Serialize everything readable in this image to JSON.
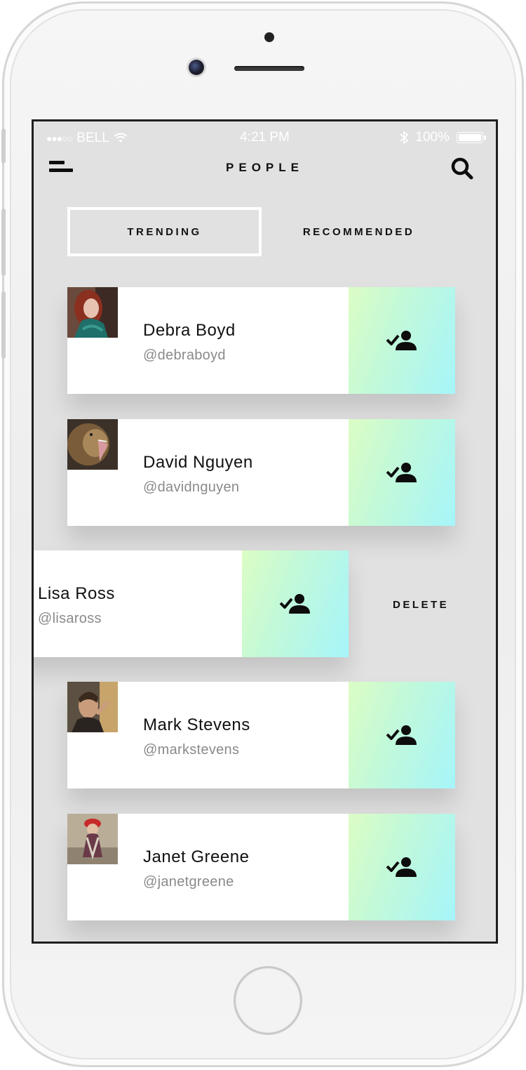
{
  "status_bar": {
    "signal": "●●●○○",
    "carrier": "BELL",
    "time": "4:21 PM",
    "battery": "100%"
  },
  "header": {
    "title": "PEOPLE"
  },
  "tabs": [
    {
      "label": "TRENDING",
      "active": true
    },
    {
      "label": "RECOMMENDED",
      "active": false
    }
  ],
  "people": [
    {
      "name": "Debra Boyd",
      "handle": "@debraboyd",
      "avatar": "woman-red-hair-photo"
    },
    {
      "name": "David Nguyen",
      "handle": "@davidnguyen",
      "avatar": "lion-photo"
    },
    {
      "name": "Lisa Ross",
      "handle": "@lisaross",
      "swiped": true
    },
    {
      "name": "Mark Stevens",
      "handle": "@markstevens",
      "avatar": "man-photo"
    },
    {
      "name": "Janet Greene",
      "handle": "@janetgreene",
      "avatar": "woman-red-cap-photo"
    }
  ],
  "swipe_action": {
    "label": "DELETE"
  },
  "icons": {
    "menu": "menu-icon",
    "search": "search-icon",
    "followed": "person-check-icon"
  },
  "colors": {
    "screen_bg": "#e1e1e1",
    "action_gradient_start": "#dcfdc4",
    "action_gradient_end": "#a6f5fa"
  }
}
